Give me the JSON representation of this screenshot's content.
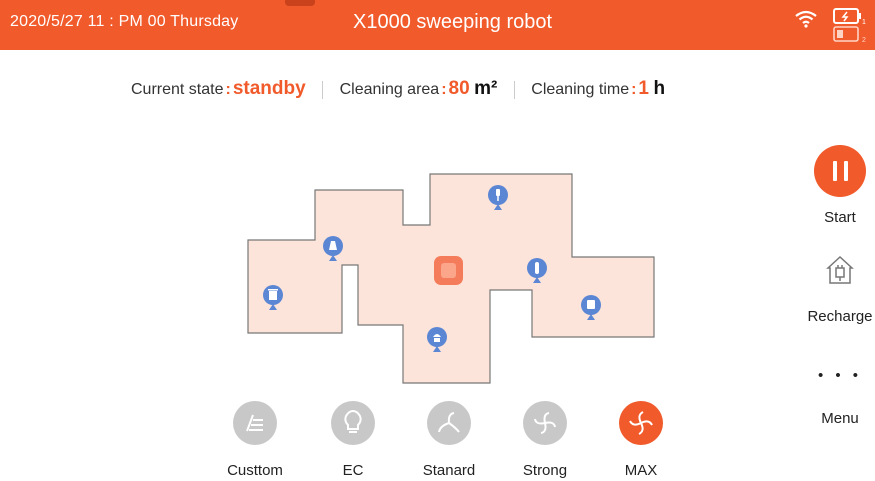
{
  "header": {
    "datetime": "2020/5/27 11 : PM 00 Thursday",
    "title": "X1000 sweeping robot"
  },
  "status": {
    "state_label": "Current state",
    "state_value": "standby",
    "area_label": "Cleaning area",
    "area_value": "80",
    "area_unit": "m²",
    "time_label": "Cleaning time",
    "time_value": "1",
    "time_unit": "h",
    "separator": ":"
  },
  "modes": [
    {
      "label": "Custtom",
      "icon": "custom-icon",
      "active": false
    },
    {
      "label": "EC",
      "icon": "bulb-icon",
      "active": false
    },
    {
      "label": "Stanard",
      "icon": "fan-icon",
      "active": false
    },
    {
      "label": "Strong",
      "icon": "fan-icon",
      "active": false
    },
    {
      "label": "MAX",
      "icon": "fan-icon",
      "active": true
    }
  ],
  "side": {
    "start_label": "Start",
    "recharge_label": "Recharge",
    "menu_label": "Menu",
    "menu_dots": "• • •"
  },
  "map": {
    "pins": [
      "trash-can-icon",
      "lamp-icon",
      "charger-icon",
      "bottle-icon",
      "plant-icon",
      "tv-icon"
    ]
  },
  "colors": {
    "accent": "#f15a2b",
    "map_fill": "#fce4da",
    "pin": "#5b86d4",
    "mode_inactive": "#c8c8c8"
  }
}
